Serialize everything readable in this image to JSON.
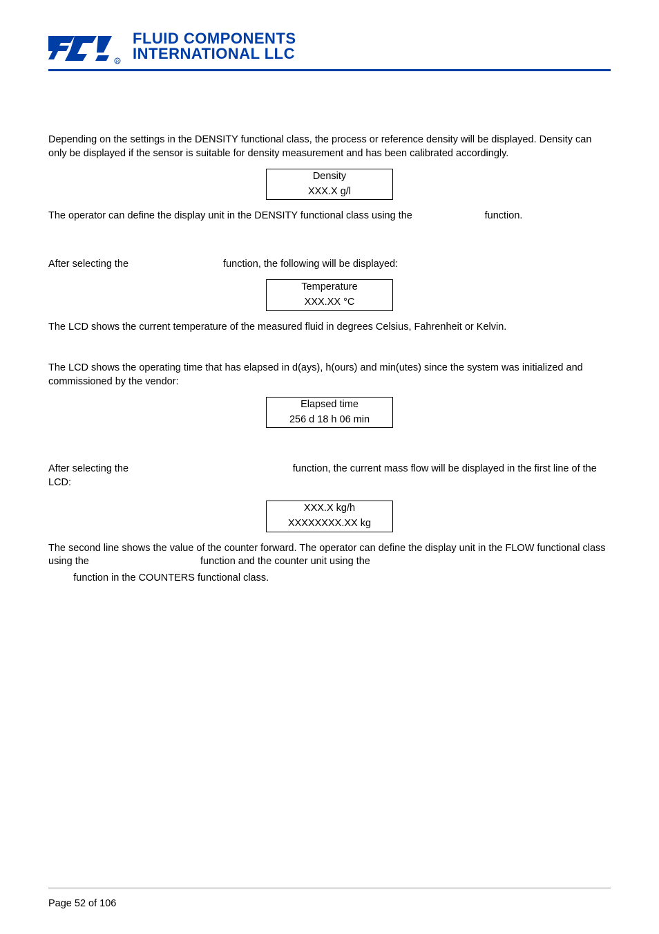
{
  "brand": {
    "line1": "FLUID COMPONENTS",
    "line2": "INTERNATIONAL LLC"
  },
  "section1": {
    "para": "Depending on the settings in the DENSITY functional class, the process or reference density will be displayed. Density can only be displayed if the sensor is suitable for density measurement and has been calibrated accordingly.",
    "lcd_line1": "Density",
    "lcd_line2": "XXX.X g/l",
    "after": "The operator can define the display unit in the DENSITY functional class using the                          function."
  },
  "section2": {
    "intro": "After selecting the                                  function, the following will be displayed:",
    "lcd_line1": "Temperature",
    "lcd_line2": "XXX.XX °C",
    "after": "The LCD shows the current temperature of the measured fluid in degrees Celsius, Fahrenheit or Kelvin."
  },
  "section3": {
    "para": "The LCD shows the operating time that has elapsed in d(ays), h(ours) and min(utes) since the system was initialized and commissioned by the vendor:",
    "lcd_line1": "Elapsed time",
    "lcd_line2": "256 d 18 h 06 min"
  },
  "section4": {
    "intro": "After selecting the                                                           function, the current mass flow will be displayed in the first line of the LCD:",
    "lcd_line1": "XXX.X kg/h",
    "lcd_line2": "XXXXXXXX.XX kg",
    "after1": "The second line shows the value of the counter forward. The operator can define the display unit in the FLOW functional class using the                                        function and the counter unit using the",
    "after2": "         function in the COUNTERS functional class."
  },
  "footer": {
    "page": "Page 52 of 106"
  }
}
